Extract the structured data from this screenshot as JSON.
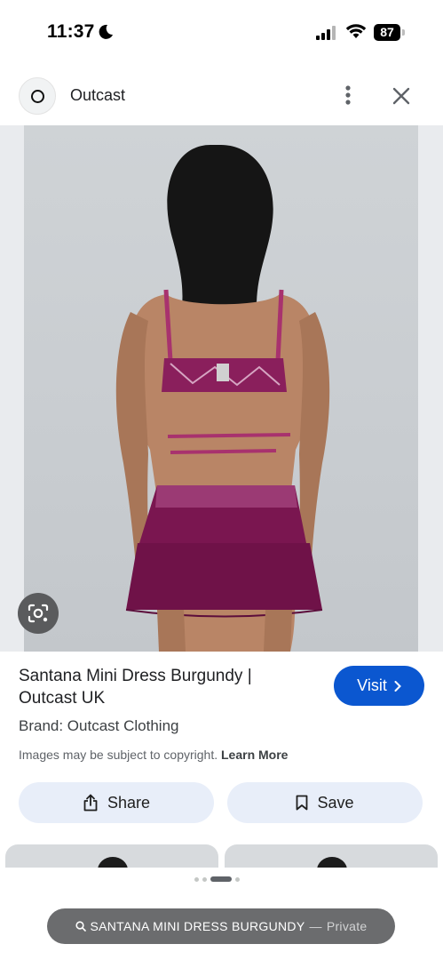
{
  "status_bar": {
    "time": "11:37",
    "battery": "87"
  },
  "header": {
    "site_name": "Outcast",
    "site_initial": "O"
  },
  "result": {
    "title": "Santana Mini Dress Burgundy | Outcast UK",
    "visit_label": "Visit",
    "brand": "Brand: Outcast Clothing",
    "copyright_text": "Images may be subject to copyright.",
    "learn_more": "Learn More"
  },
  "actions": {
    "share_label": "Share",
    "save_label": "Save"
  },
  "carousel": {
    "dots": 4,
    "active_index": 2
  },
  "search_pill": {
    "query": "SANTANA MINI DRESS BURGUNDY",
    "separator": "—",
    "mode": "Private"
  },
  "colors": {
    "accent": "#0b57d0",
    "action_bg": "#e8eef9",
    "dress": "#7a1650"
  },
  "icons": [
    "moon-icon",
    "signal-icon",
    "wifi-icon",
    "more-vert-icon",
    "close-icon",
    "lens-icon",
    "chevron-right-icon",
    "share-icon",
    "bookmark-icon",
    "search-icon"
  ]
}
